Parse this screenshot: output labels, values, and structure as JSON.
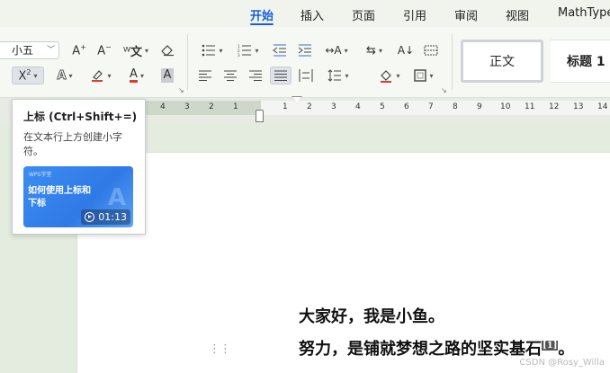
{
  "menubar": {
    "tabs": [
      {
        "label": "开始",
        "active": true
      },
      {
        "label": "插入"
      },
      {
        "label": "页面"
      },
      {
        "label": "引用"
      },
      {
        "label": "审阅"
      },
      {
        "label": "视图"
      },
      {
        "label": "MathType"
      }
    ]
  },
  "ribbon": {
    "font_size_value": "小五",
    "icons": {
      "grow_font": "A⁺",
      "shrink_font": "A⁻",
      "phonetic": "wén",
      "clear_format": "eraser",
      "superscript": "X²",
      "text_effect": "A",
      "highlight": "pen",
      "font_color": "A",
      "char_shading": "A"
    },
    "font_color_accent": "#e23b2e",
    "highlight_accent": "#e23b2e",
    "styles": {
      "normal_label": "正文",
      "heading1_label": "标题 1"
    }
  },
  "ruler": {
    "left_numbers": [
      "4",
      "3",
      "2",
      "1"
    ],
    "right_numbers": [
      "1",
      "2",
      "3",
      "4",
      "5",
      "6",
      "7",
      "8",
      "9",
      "10",
      "11",
      "12",
      "13",
      "14"
    ]
  },
  "tooltip": {
    "title": "上标 (Ctrl+Shift+=)",
    "description": "在文本行上方创建小字符。",
    "card_brand": "WPS学堂",
    "card_title": "如何使用上标和下标",
    "duration": "01:13"
  },
  "document": {
    "line1": "大家好，我是小鱼。",
    "line2_text": "努力，是铺就梦想之路的坚实基石",
    "line2_superscript": "[1]",
    "line2_end": "。"
  },
  "watermark": "CSDN @Rosy_Willa",
  "colors": {
    "accent": "#1b5fd8",
    "card_blue": "#2f79e6"
  }
}
